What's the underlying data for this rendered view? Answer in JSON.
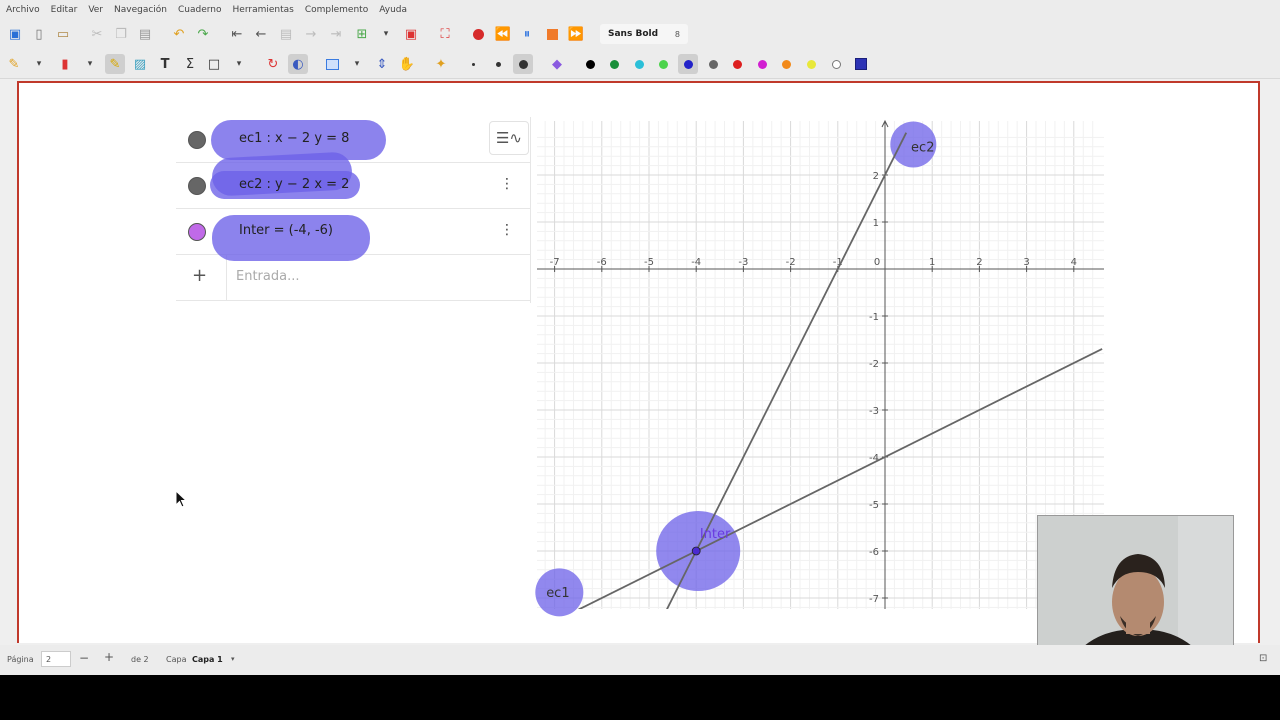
{
  "menubar": [
    "Archivo",
    "Editar",
    "Ver",
    "Navegación",
    "Cuaderno",
    "Herramientas",
    "Complemento",
    "Ayuda"
  ],
  "toolbar": {
    "font_name": "Sans Bold",
    "font_size": "8",
    "pen_colors": [
      "#000000",
      "#1a8f3a",
      "#2bbfd8",
      "#4cd34c",
      "#2222c9",
      "#666666",
      "#dd1f1f",
      "#d11fd1",
      "#f28a1a",
      "#e8e83a",
      "#ffffff",
      "#2d33b5"
    ]
  },
  "algebra": {
    "rows": [
      {
        "label": "ec1 : x − 2 y = 8",
        "dot_color": "#666666"
      },
      {
        "label": "ec2 : y − 2 x = 2",
        "dot_color": "#666666"
      },
      {
        "label": "Inter = (-4, -6)",
        "dot_color": "#c06ae8"
      }
    ],
    "input_placeholder": "Entrada..."
  },
  "chart_data": {
    "type": "line",
    "xlim": [
      -7.4,
      4.6
    ],
    "ylim": [
      -7.4,
      2.9
    ],
    "x_ticks": [
      -7,
      -6,
      -5,
      -4,
      -3,
      -2,
      -1,
      0,
      1,
      2,
      3,
      4
    ],
    "y_ticks": [
      -7,
      -6,
      -5,
      -4,
      -3,
      -2,
      -1,
      1,
      2
    ],
    "grid": true,
    "series": [
      {
        "name": "ec1",
        "equation": "x - 2y = 8",
        "x": [
          -7.4,
          4.6
        ],
        "y": [
          -7.7,
          -1.7
        ]
      },
      {
        "name": "ec2",
        "equation": "y - 2x = 2",
        "x": [
          -4.9,
          0.45
        ],
        "y": [
          -7.8,
          2.9
        ]
      }
    ],
    "points": [
      {
        "name": "Inter",
        "x": -4,
        "y": -6
      }
    ],
    "labels": [
      "ec1",
      "ec2",
      "Inter"
    ]
  },
  "status": {
    "page_label": "Página",
    "page_number": "2",
    "of_label": "de 2",
    "layer_label": "Capa",
    "layer_value": "Capa 1"
  },
  "colors": {
    "highlight": "#6c60e8",
    "page_border": "#c0392b",
    "graph_line": "#666666"
  }
}
